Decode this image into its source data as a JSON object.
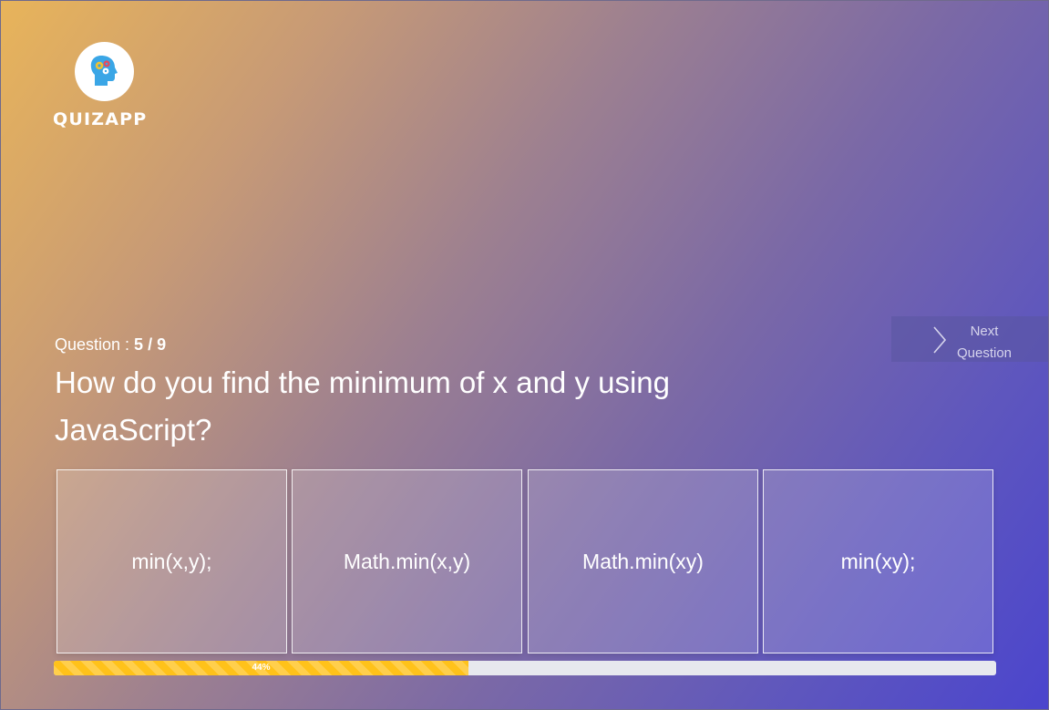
{
  "brand": {
    "name": "QUIZAPP",
    "logo_icon": "head-with-gears-icon"
  },
  "question": {
    "counter_label": "Question : ",
    "current": "5",
    "separator": " / ",
    "total": "9",
    "text": "How do you find the minimum of x and y using JavaScript?"
  },
  "next_button": {
    "icon": "chevron-right-icon",
    "label_line1": "Next",
    "label_line2": "Question"
  },
  "answers": [
    {
      "label": "min(x,y);"
    },
    {
      "label": "Math.min(x,y)"
    },
    {
      "label": "Math.min(xy)"
    },
    {
      "label": "min(xy);"
    }
  ],
  "progress": {
    "value_percent": 44,
    "label": "44%"
  },
  "colors": {
    "progress_fill": "#ffc21a",
    "progress_track": "#e7e8ee",
    "gradient_start": "#e8b45a",
    "gradient_end": "#4b45cd"
  }
}
